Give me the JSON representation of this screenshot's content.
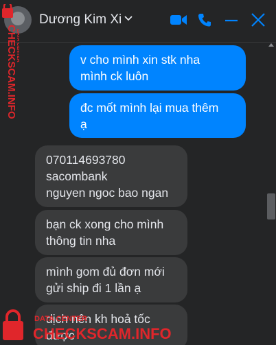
{
  "header": {
    "contact_name": "Dương Kim Xi",
    "icons": [
      "chevron-down-icon",
      "video-call-icon",
      "phone-call-icon",
      "minimize-icon",
      "close-icon"
    ],
    "accent_color": "#0084ff"
  },
  "messages": [
    {
      "side": "outgoing",
      "lines": [
        "v cho mình xin stk nha",
        "mình ck luôn"
      ]
    },
    {
      "side": "outgoing",
      "lines": [
        "đc mốt mình lại mua thêm",
        "ạ"
      ]
    },
    {
      "side": "incoming",
      "lines": [
        "070114693780",
        "sacombank",
        "nguyen ngoc bao ngan"
      ]
    },
    {
      "side": "incoming",
      "lines": [
        "bạn ck xong cho mình",
        "thông tin nha"
      ]
    },
    {
      "side": "incoming",
      "lines": [
        "mình gom đủ đơn mới",
        "gửi ship đi 1 lần ạ"
      ]
    },
    {
      "side": "incoming",
      "lines": [
        "dịch nên kh hoả tốc",
        "được"
      ]
    }
  ],
  "watermark": {
    "brand": "CHECKSCAM.INFO",
    "subtitle": "DATA CENTER"
  }
}
